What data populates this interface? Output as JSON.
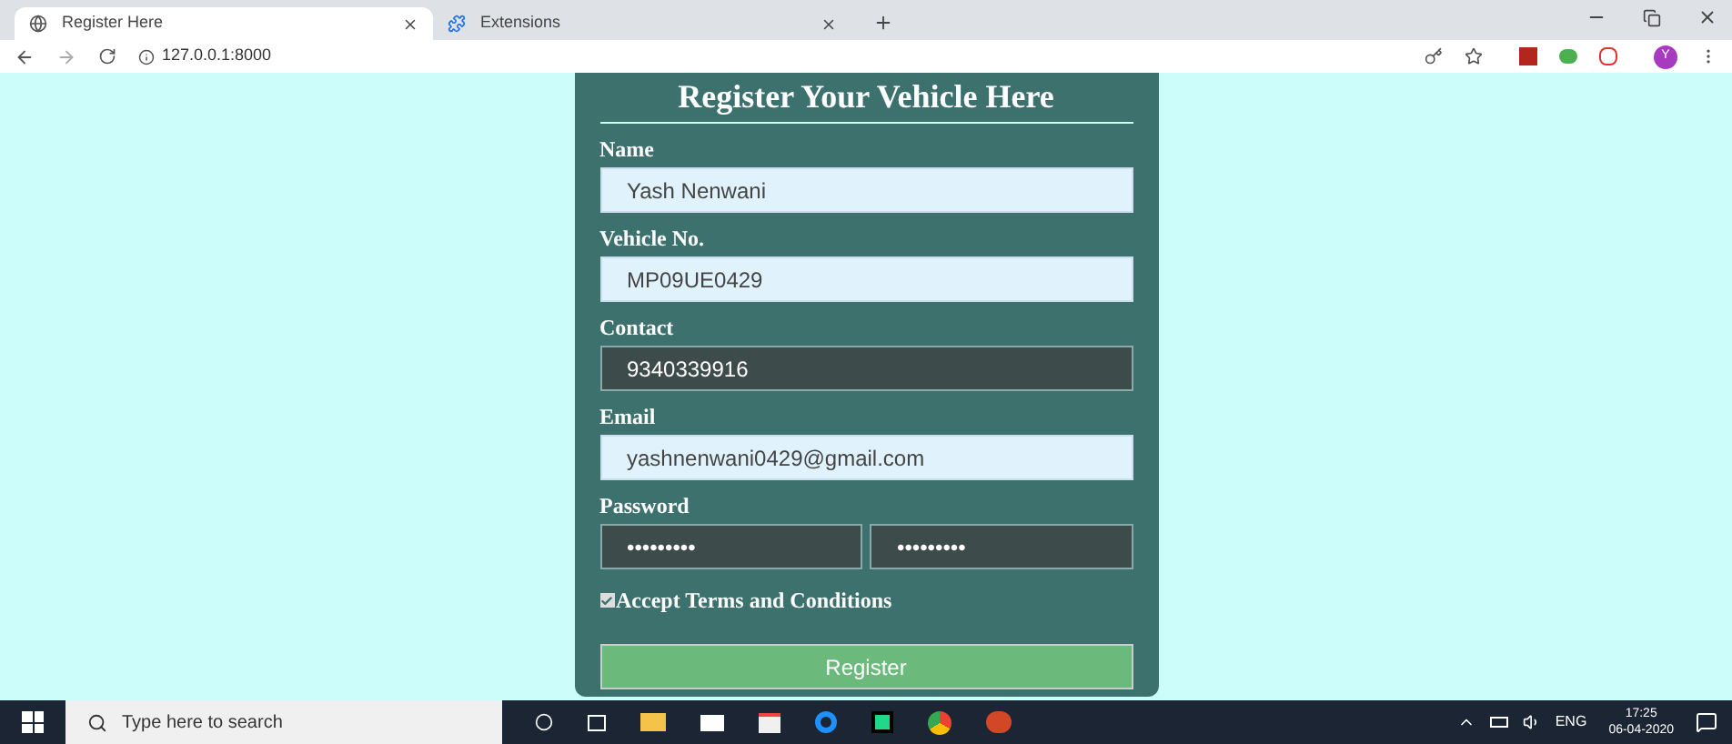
{
  "browser": {
    "tabs": [
      {
        "title": "Register Here",
        "selected": true
      },
      {
        "title": "Extensions",
        "selected": false
      }
    ],
    "address": "127.0.0.1:8000",
    "profile_initial": "Y"
  },
  "form": {
    "title": "Register Your Vehicle Here",
    "fields": [
      {
        "label": "Name",
        "values": [
          "Yash Nenwani"
        ],
        "dark": false
      },
      {
        "label": "Vehicle No.",
        "values": [
          "MP09UE0429"
        ],
        "dark": false
      },
      {
        "label": "Contact",
        "values": [
          "9340339916"
        ],
        "dark": true
      },
      {
        "label": "Email",
        "values": [
          "yashnenwani0429@gmail.com"
        ],
        "dark": false
      },
      {
        "label": "Password",
        "values": [
          "•••••••••",
          "•••••••••"
        ],
        "dark": true
      }
    ],
    "terms": {
      "label": "Accept Terms and Conditions",
      "checked": true
    },
    "submit": "Register"
  },
  "taskbar": {
    "search_placeholder": "Type here to search",
    "language": "ENG",
    "time": "17:25",
    "date": "06-04-2020"
  }
}
